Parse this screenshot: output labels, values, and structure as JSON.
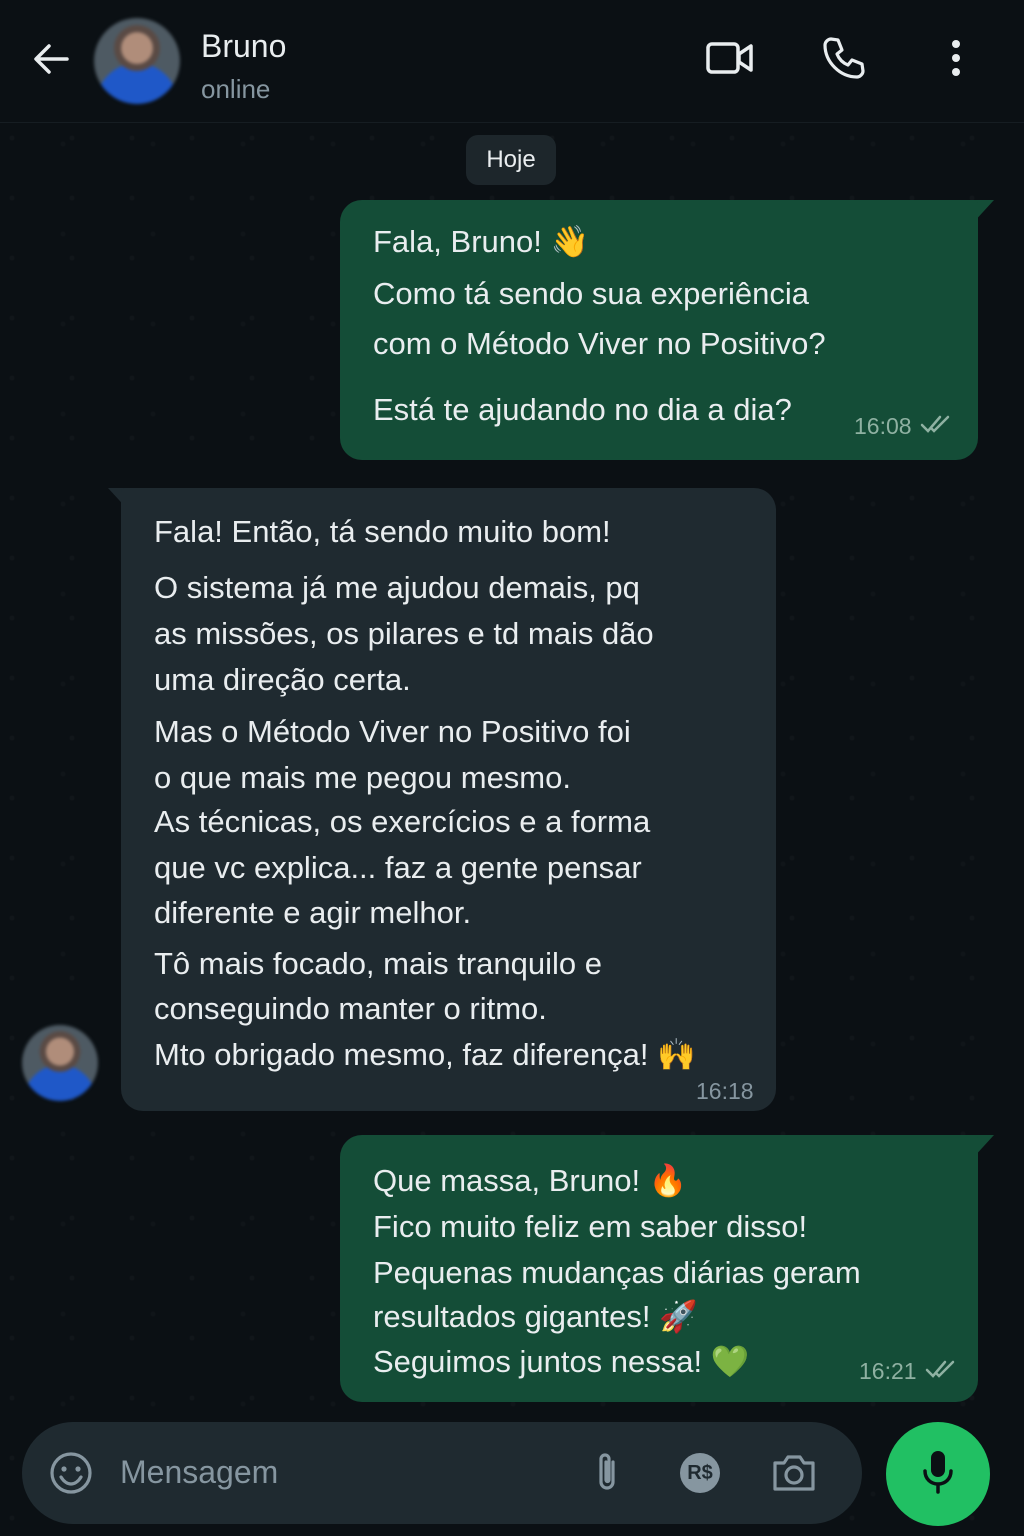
{
  "header": {
    "contact_name": "Bruno",
    "status": "online",
    "icons": [
      "back-arrow-icon",
      "video-call-icon",
      "phone-icon",
      "more-vertical-icon"
    ]
  },
  "date_separator": "Hoje",
  "messages": [
    {
      "direction": "outgoing",
      "lines": [
        "Fala, Bruno! 👋",
        "Como tá sendo sua experiência",
        "com o Método Viver no Positivo?",
        "Está te ajudando no dia a dia?"
      ],
      "time": "16:08",
      "status_icon": "double-check-icon"
    },
    {
      "direction": "incoming",
      "lines": [
        "Fala! Então, tá sendo muito bom!",
        "O sistema já me ajudou demais, pq",
        "as missões, os pilares e td mais dão",
        "uma direção certa.",
        "Mas o Método Viver no Positivo foi",
        "o que mais me pegou mesmo.",
        "As técnicas, os exercícios e a forma",
        "que vc explica... faz a gente pensar",
        "diferente e agir melhor.",
        "Tô mais focado, mais tranquilo e",
        "conseguindo manter o ritmo.",
        "Mto obrigado mesmo, faz diferença! 🙌"
      ],
      "time": "16:18"
    },
    {
      "direction": "outgoing",
      "lines": [
        "Que massa, Bruno! 🔥",
        "Fico muito feliz em saber disso!",
        "Pequenas mudanças diárias geram",
        "resultados gigantes! 🚀",
        "Seguimos juntos nessa! 💚"
      ],
      "time": "16:21",
      "status_icon": "double-check-icon"
    }
  ],
  "composer": {
    "placeholder": "Mensagem",
    "icons": [
      "emoji-icon",
      "attachment-icon",
      "payment-icon",
      "camera-icon",
      "microphone-icon"
    ],
    "payment_label": "R$"
  },
  "colors": {
    "background": "#0b1014",
    "outgoing_bubble": "#144d37",
    "incoming_bubble": "#1f2a30",
    "accent": "#21c063"
  }
}
